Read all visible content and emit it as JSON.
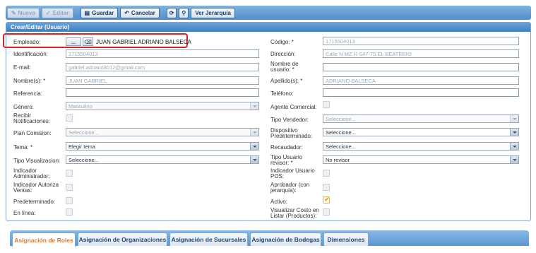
{
  "toolbar": {
    "nuevo": "Nuevo",
    "editar": "Editar",
    "guardar": "Guardar",
    "cancelar": "Cancelar",
    "jerarquia": "Ver Jerarquía"
  },
  "panel": {
    "title": "Crear/Editar (Usuario)"
  },
  "left": {
    "empleado": {
      "label": "Empleado:",
      "button": "...",
      "value": "JUAN GABRIEL ADRIANO BALSECA"
    },
    "identificacion": {
      "label": "Identificación:",
      "value": "1715504013"
    },
    "email": {
      "label": "E-mail:",
      "value": "gabriel.adriano3012@gmail.com"
    },
    "nombres": {
      "label": "Nombre(s): *",
      "value": "JUAN GABRIEL"
    },
    "referencia": {
      "label": "Referencia:",
      "value": ""
    },
    "genero": {
      "label": "Género:",
      "value": "Masculino"
    },
    "recibir": {
      "label": "Recibir\nNotificaciones:"
    },
    "plan": {
      "label": "Plan Comision:",
      "value": "Seleccione..."
    },
    "tema": {
      "label": "Tema: *",
      "value": "Elegir tema"
    },
    "tipo_vis": {
      "label": "Tipo Visualizacion:",
      "value": "Seleccione..."
    },
    "ind_admin": {
      "label": "Indicador\nAdministrador:"
    },
    "ind_aut": {
      "label": "Indicador Autoriza\nVentas:"
    },
    "predet": {
      "label": "Predeterminado:"
    },
    "enlinea": {
      "label": "En línea:"
    }
  },
  "right": {
    "codigo": {
      "label": "Código: *",
      "value": "1715504013"
    },
    "direccion": {
      "label": "Dirección:",
      "value": "Calle N   MZ H S47-75 EL BEATERIO"
    },
    "nombre_usuario": {
      "label": "Nombre de\nusuario: *",
      "value": ""
    },
    "apellidos": {
      "label": "Apellido(s): *",
      "value": "ADRIANO BALSECA"
    },
    "telefono": {
      "label": "Teléfono:",
      "value": ""
    },
    "agente": {
      "label": "Agente Comercial:"
    },
    "tipo_vendedor": {
      "label": "Tipo Vendedor:",
      "value": "Seleccione..."
    },
    "dispositivo": {
      "label": "Dispositivo\nPredeterminado:",
      "value": "Seleccione..."
    },
    "recaudador": {
      "label": "Recaudador:",
      "value": "Seleccione..."
    },
    "tipo_usuario": {
      "label": "Tipo Usuario\nrevisor: *",
      "value": "No revisor"
    },
    "ind_pos": {
      "label": "Indicador Usuario\nPOS:"
    },
    "aprobador": {
      "label": "Aprobador (con\njerarquía):"
    },
    "activo": {
      "label": "Activo:"
    },
    "costo": {
      "label": "Visualizar Costo en\nListar (Productos):"
    }
  },
  "tabs": [
    {
      "label": "Asignación de Roles"
    },
    {
      "label": "Asignación de Organizaciones"
    },
    {
      "label": "Asignación de Sucursales"
    },
    {
      "label": "Asignación de Bodegas"
    },
    {
      "label": "Dimensiones"
    }
  ],
  "colors": {
    "accent": "#4f8fcc",
    "highlight": "#d62424",
    "active_tab": "#e0782b"
  }
}
